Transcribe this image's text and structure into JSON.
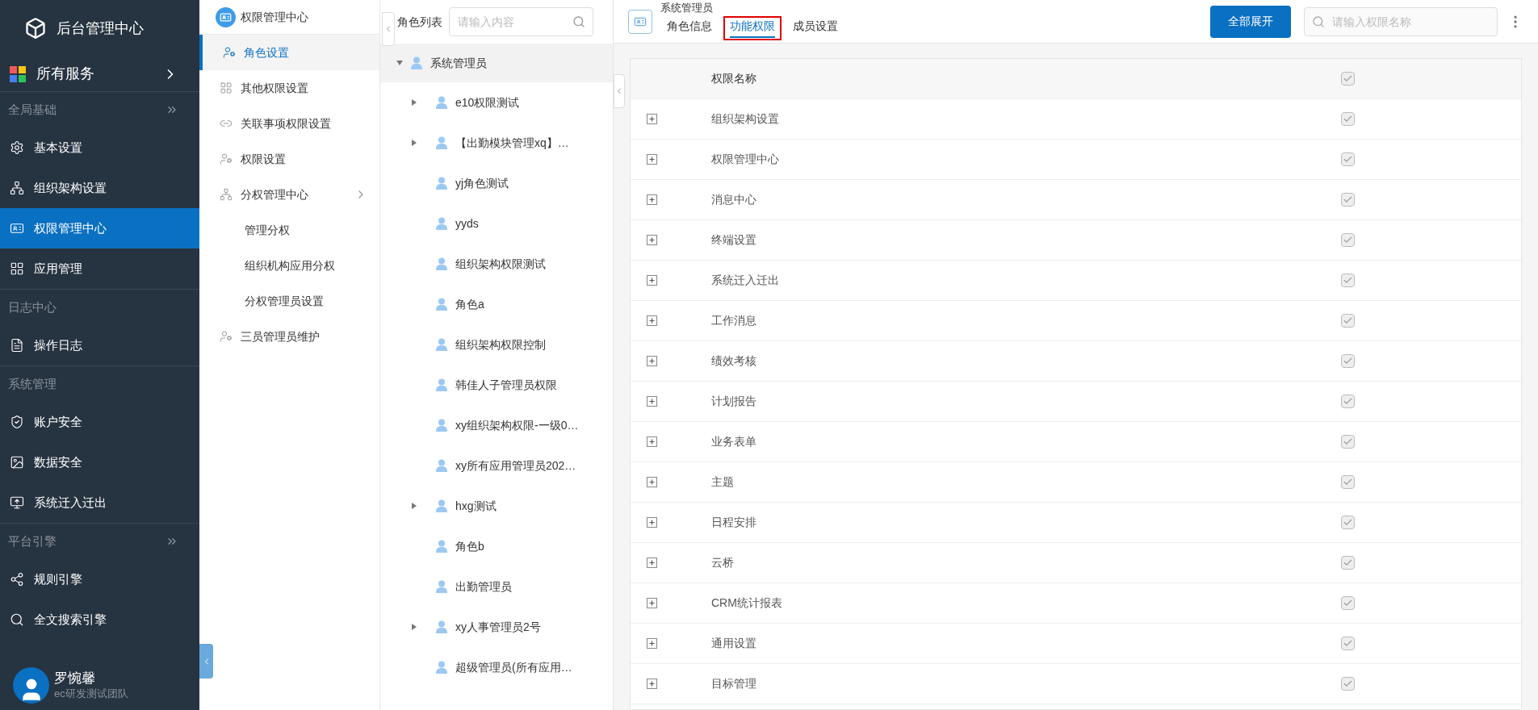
{
  "app": {
    "title": "后台管理中心"
  },
  "all_services": {
    "label": "所有服务"
  },
  "sidebar": {
    "sections": [
      {
        "title": "全局基础",
        "collapsible": true,
        "items": [
          {
            "label": "基本设置",
            "selected": false
          },
          {
            "label": "组织架构设置",
            "selected": false
          },
          {
            "label": "权限管理中心",
            "selected": true
          },
          {
            "label": "应用管理",
            "selected": false
          }
        ]
      },
      {
        "title": "日志中心",
        "collapsible": false,
        "items": [
          {
            "label": "操作日志",
            "selected": false
          }
        ]
      },
      {
        "title": "系统管理",
        "collapsible": false,
        "items": [
          {
            "label": "账户安全",
            "selected": false
          },
          {
            "label": "数据安全",
            "selected": false
          },
          {
            "label": "系统迁入迁出",
            "selected": false
          }
        ]
      },
      {
        "title": "平台引擎",
        "collapsible": true,
        "items": [
          {
            "label": "规则引擎",
            "selected": false
          },
          {
            "label": "全文搜索引擎",
            "selected": false
          }
        ]
      }
    ]
  },
  "user": {
    "name": "罗惋馨",
    "team": "ec研发测试团队"
  },
  "submenu": {
    "title": "权限管理中心",
    "items": [
      {
        "label": "角色设置",
        "selected": true
      },
      {
        "label": "其他权限设置",
        "selected": false
      },
      {
        "label": "关联事项权限设置",
        "selected": false
      },
      {
        "label": "权限设置",
        "selected": false
      },
      {
        "label": "分权管理中心",
        "selected": false,
        "children": [
          {
            "label": "管理分权",
            "selected": false
          },
          {
            "label": "组织机构应用分权",
            "selected": false
          },
          {
            "label": "分权管理员设置",
            "selected": false
          }
        ]
      },
      {
        "label": "三员管理员维护",
        "selected": false
      }
    ]
  },
  "role_list": {
    "title": "角色列表",
    "search": {
      "placeholder": "请输入内容"
    },
    "root": {
      "label": "系统管理员",
      "expanded": true,
      "selected": true
    },
    "items": [
      {
        "label": "e10权限测试",
        "kind": "branch",
        "expanded": false
      },
      {
        "label": "【出勤模块管理xq】…",
        "kind": "branch",
        "expanded": false
      },
      {
        "label": "yj角色测试",
        "kind": "leaf"
      },
      {
        "label": "yyds",
        "kind": "leaf"
      },
      {
        "label": "组织架构权限测试",
        "kind": "leaf"
      },
      {
        "label": "角色a",
        "kind": "leaf"
      },
      {
        "label": "组织架构权限控制",
        "kind": "leaf"
      },
      {
        "label": "韩佳人子管理员权限",
        "kind": "leaf"
      },
      {
        "label": "xy组织架构权限-一级0…",
        "kind": "leaf"
      },
      {
        "label": "xy所有应用管理员202…",
        "kind": "leaf"
      },
      {
        "label": "hxg测试",
        "kind": "branch",
        "expanded": false
      },
      {
        "label": "角色b",
        "kind": "leaf"
      },
      {
        "label": "出勤管理员",
        "kind": "leaf"
      },
      {
        "label": "xy人事管理员2号",
        "kind": "branch",
        "expanded": false
      },
      {
        "label": "超级管理员(所有应用…",
        "kind": "leaf"
      }
    ]
  },
  "role_header": {
    "name": "系统管理员",
    "tabs": [
      {
        "label": "角色信息",
        "selected": false,
        "highlighted": false
      },
      {
        "label": "功能权限",
        "selected": true,
        "highlighted": true
      },
      {
        "label": "成员设置",
        "selected": false,
        "highlighted": false
      }
    ],
    "expand_button": "全部展开",
    "search": {
      "placeholder": "请输入权限名称"
    }
  },
  "table": {
    "columns": [
      "权限名称"
    ],
    "header_checked": true,
    "rows": [
      {
        "name": "组织架构设置",
        "checked": true
      },
      {
        "name": "权限管理中心",
        "checked": true
      },
      {
        "name": "消息中心",
        "checked": true
      },
      {
        "name": "终端设置",
        "checked": true
      },
      {
        "name": "系统迁入迁出",
        "checked": true
      },
      {
        "name": "工作消息",
        "checked": true
      },
      {
        "name": "绩效考核",
        "checked": true
      },
      {
        "name": "计划报告",
        "checked": true
      },
      {
        "name": "业务表单",
        "checked": true
      },
      {
        "name": "主题",
        "checked": true
      },
      {
        "name": "日程安排",
        "checked": true
      },
      {
        "name": "云桥",
        "checked": true
      },
      {
        "name": "CRM统计报表",
        "checked": true
      },
      {
        "name": "通用设置",
        "checked": true
      },
      {
        "name": "目标管理",
        "checked": true
      }
    ]
  }
}
